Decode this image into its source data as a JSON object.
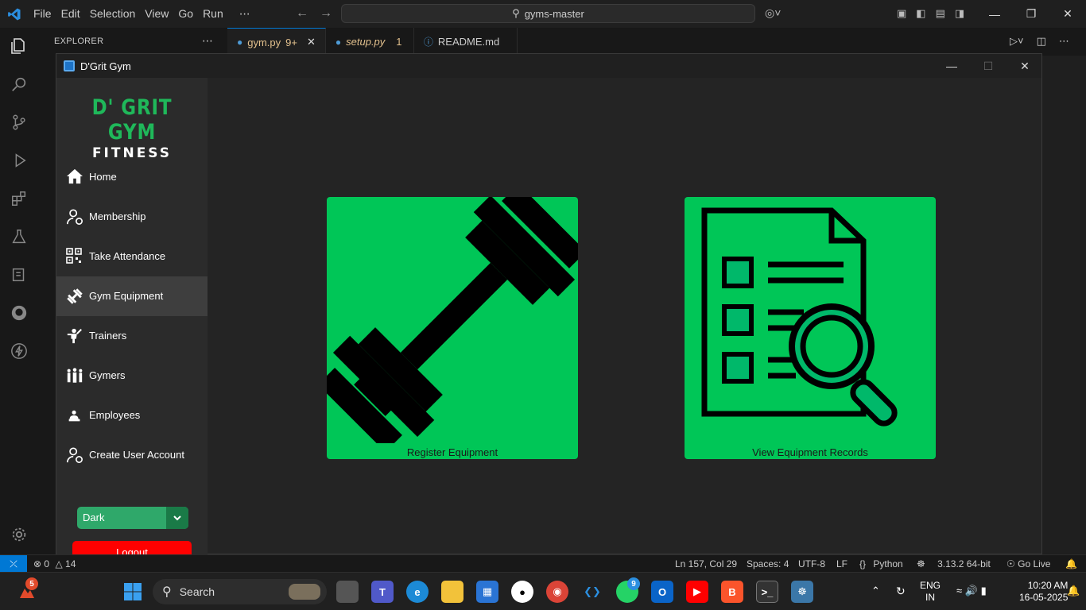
{
  "vscode": {
    "menu": [
      "File",
      "Edit",
      "Selection",
      "View",
      "Go",
      "Run",
      "⋯"
    ],
    "search": "gyms-master",
    "explorer_title": "EXPLORER",
    "tabs": [
      {
        "name": "gym.py",
        "badge": "9+",
        "active": true,
        "color": "#e2c08d"
      },
      {
        "name": "setup.py",
        "badge": "1",
        "active": false,
        "color": "#e2c08d"
      },
      {
        "name": "README.md",
        "badge": "",
        "active": false,
        "color": "#cccccc"
      }
    ],
    "status": {
      "errors": "0",
      "warnings": "14",
      "position": "Ln 157, Col 29",
      "spaces": "Spaces: 4",
      "encoding": "UTF-8",
      "eol": "LF",
      "language": "Python",
      "interpreter": "3.13.2 64-bit",
      "golive": "Go Live"
    }
  },
  "app": {
    "title": "D'Grit Gym",
    "brand_line1": "D' GRIT GYM",
    "brand_line2": "FITNESS",
    "nav": [
      {
        "label": "Home",
        "icon": "home-icon"
      },
      {
        "label": "Membership",
        "icon": "member-icon"
      },
      {
        "label": "Take Attendance",
        "icon": "qr-code-icon"
      },
      {
        "label": "Gym Equipment",
        "icon": "dumbbell-icon",
        "active": true
      },
      {
        "label": "Trainers",
        "icon": "trainer-icon"
      },
      {
        "label": "Gymers",
        "icon": "group-icon"
      },
      {
        "label": "Employees",
        "icon": "employee-icon"
      },
      {
        "label": "Create User Account",
        "icon": "add-user-icon"
      }
    ],
    "theme_value": "Dark",
    "logout_label": "Logout",
    "cards": {
      "register": "Register Equipment",
      "view": "View Equipment Records"
    },
    "accent_color": "#00c657",
    "logout_color": "#ff0000"
  },
  "taskbar": {
    "search_label": "Search",
    "whatsapp_badge": "9",
    "start_badge": "5",
    "lang1": "ENG",
    "lang2": "IN",
    "time": "10:20 AM",
    "date": "16-05-2025"
  }
}
